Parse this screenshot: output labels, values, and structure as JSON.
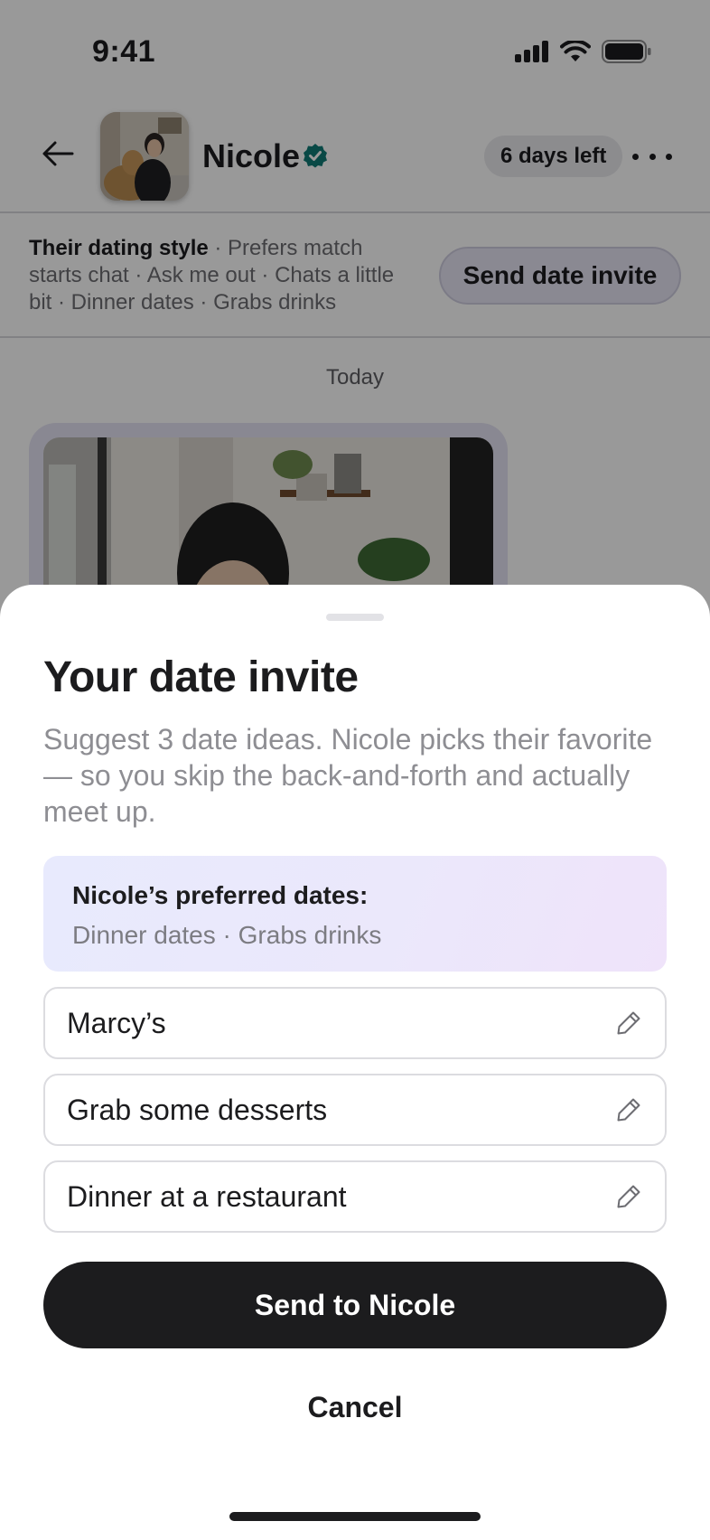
{
  "status_bar": {
    "time": "9:41",
    "icons": [
      "cellular-signal-icon",
      "wifi-icon",
      "battery-icon"
    ]
  },
  "chat_header": {
    "back_icon": "arrow-left-icon",
    "contact_name": "Nicole",
    "verified_icon": "verified-badge-icon",
    "days_left": "6 days left",
    "more_icon": "more-horizontal-icon"
  },
  "dating_style": {
    "label": "Their dating style",
    "details": " · Prefers match starts chat · Ask me out · Chats a little bit · Dinner dates · Grabs drinks",
    "send_invite_label": "Send date invite"
  },
  "conversation": {
    "day_divider": "Today"
  },
  "sheet": {
    "title": "Your date invite",
    "description": "Suggest 3 date ideas. Nicole picks their favorite — so you skip the back-and-forth and actually meet up.",
    "preferences": {
      "title": "Nicole’s preferred dates:",
      "values": "Dinner dates · Grabs drinks"
    },
    "ideas": [
      {
        "text": "Marcy’s",
        "icon": "pencil-icon"
      },
      {
        "text": "Grab some desserts",
        "icon": "pencil-icon"
      },
      {
        "text": "Dinner at a restaurant",
        "icon": "pencil-icon"
      }
    ],
    "send_label": "Send to Nicole",
    "cancel_label": "Cancel"
  },
  "colors": {
    "primary_button": "#1c1c1e",
    "verified_badge": "#0f7a75",
    "preference_card_start": "#e8eafd",
    "preference_card_end": "#efe3fa",
    "overlay": "rgba(0,0,0,0.40)"
  }
}
